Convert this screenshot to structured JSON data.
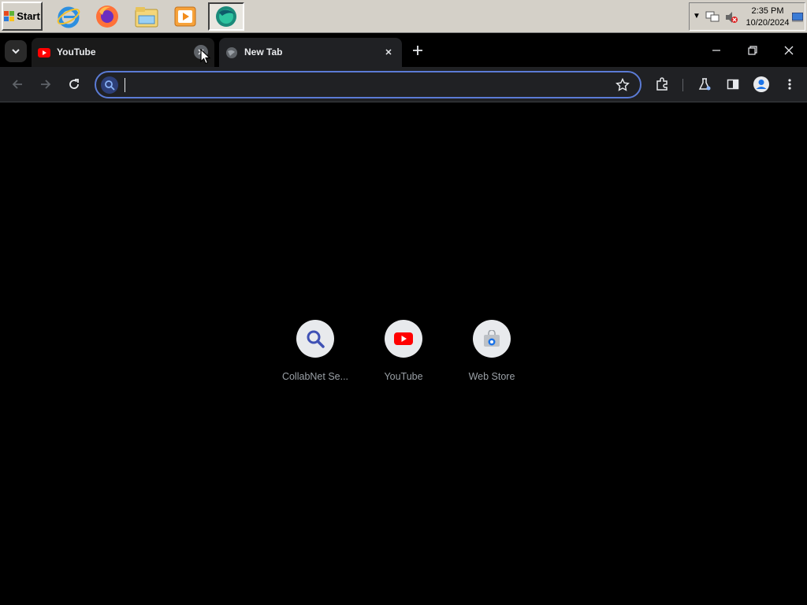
{
  "taskbar": {
    "start_label": "Start",
    "quick_launch": [
      {
        "name": "internet-explorer-icon"
      },
      {
        "name": "firefox-icon"
      },
      {
        "name": "file-explorer-icon"
      },
      {
        "name": "media-player-icon"
      },
      {
        "name": "browser-icon",
        "active": true
      }
    ],
    "clock": {
      "time": "2:35 PM",
      "date": "10/20/2024"
    }
  },
  "browser": {
    "tabs": [
      {
        "title": "YouTube",
        "active": false
      },
      {
        "title": "New Tab",
        "active": true
      }
    ],
    "omnibox": {
      "value": "",
      "placeholder": ""
    },
    "colors": {
      "accent": "#5b7bd5",
      "youtube_red": "#ff0000",
      "background": "#000000"
    }
  },
  "new_tab_page": {
    "shortcuts": [
      {
        "label": "CollabNet Se...",
        "icon": "search-icon"
      },
      {
        "label": "YouTube",
        "icon": "youtube-icon"
      },
      {
        "label": "Web Store",
        "icon": "web-store-icon"
      }
    ]
  }
}
